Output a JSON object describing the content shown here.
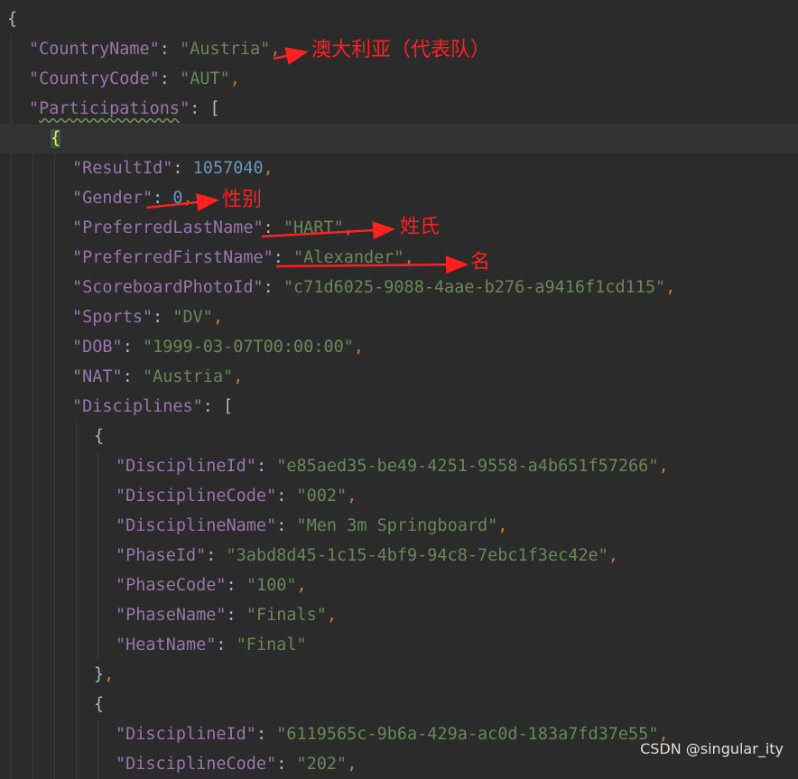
{
  "code_lines": [
    {
      "indent": 0,
      "tokens": [
        {
          "t": "{",
          "c": "b"
        }
      ]
    },
    {
      "indent": 1,
      "tokens": [
        {
          "t": "\"CountryName\"",
          "c": "k"
        },
        {
          "t": ": ",
          "c": "b"
        },
        {
          "t": "\"Austria\"",
          "c": "s"
        },
        {
          "t": ",",
          "c": "p"
        }
      ]
    },
    {
      "indent": 1,
      "tokens": [
        {
          "t": "\"CountryCode\"",
          "c": "k"
        },
        {
          "t": ": ",
          "c": "b"
        },
        {
          "t": "\"AUT\"",
          "c": "s"
        },
        {
          "t": ",",
          "c": "p"
        }
      ]
    },
    {
      "indent": 1,
      "tokens": [
        {
          "t": "\"",
          "c": "k"
        },
        {
          "t": "Participations",
          "c": "k squiggle"
        },
        {
          "t": "\"",
          "c": "k"
        },
        {
          "t": ": ",
          "c": "b"
        },
        {
          "t": "[",
          "c": "b"
        }
      ]
    },
    {
      "indent": 2,
      "current": true,
      "tokens": [
        {
          "t": "{",
          "c": "hl"
        }
      ]
    },
    {
      "indent": 3,
      "tokens": [
        {
          "t": "\"ResultId\"",
          "c": "k"
        },
        {
          "t": ": ",
          "c": "b"
        },
        {
          "t": "1057040",
          "c": "n"
        },
        {
          "t": ",",
          "c": "p"
        }
      ]
    },
    {
      "indent": 3,
      "tokens": [
        {
          "t": "\"Gender\"",
          "c": "k"
        },
        {
          "t": ": ",
          "c": "b"
        },
        {
          "t": "0",
          "c": "n"
        },
        {
          "t": ",",
          "c": "p"
        }
      ]
    },
    {
      "indent": 3,
      "tokens": [
        {
          "t": "\"PreferredLastName\"",
          "c": "k"
        },
        {
          "t": ": ",
          "c": "b"
        },
        {
          "t": "\"HART\"",
          "c": "s"
        },
        {
          "t": ",",
          "c": "p"
        }
      ]
    },
    {
      "indent": 3,
      "tokens": [
        {
          "t": "\"PreferredFirstName\"",
          "c": "k"
        },
        {
          "t": ": ",
          "c": "b"
        },
        {
          "t": "\"Alexander\"",
          "c": "s"
        },
        {
          "t": ",",
          "c": "p"
        }
      ]
    },
    {
      "indent": 3,
      "tokens": [
        {
          "t": "\"ScoreboardPhotoId\"",
          "c": "k"
        },
        {
          "t": ": ",
          "c": "b"
        },
        {
          "t": "\"c71d6025-9088-4aae-b276-a9416f1cd115\"",
          "c": "s"
        },
        {
          "t": ",",
          "c": "p"
        }
      ]
    },
    {
      "indent": 3,
      "tokens": [
        {
          "t": "\"Sports\"",
          "c": "k"
        },
        {
          "t": ": ",
          "c": "b"
        },
        {
          "t": "\"DV\"",
          "c": "s"
        },
        {
          "t": ",",
          "c": "p"
        }
      ]
    },
    {
      "indent": 3,
      "tokens": [
        {
          "t": "\"DOB\"",
          "c": "k"
        },
        {
          "t": ": ",
          "c": "b"
        },
        {
          "t": "\"1999-03-07T00:00:00\"",
          "c": "s"
        },
        {
          "t": ",",
          "c": "p"
        }
      ]
    },
    {
      "indent": 3,
      "tokens": [
        {
          "t": "\"NAT\"",
          "c": "k"
        },
        {
          "t": ": ",
          "c": "b"
        },
        {
          "t": "\"Austria\"",
          "c": "s"
        },
        {
          "t": ",",
          "c": "p"
        }
      ]
    },
    {
      "indent": 3,
      "tokens": [
        {
          "t": "\"Disciplines\"",
          "c": "k"
        },
        {
          "t": ": ",
          "c": "b"
        },
        {
          "t": "[",
          "c": "b"
        }
      ]
    },
    {
      "indent": 4,
      "tokens": [
        {
          "t": "{",
          "c": "b"
        }
      ]
    },
    {
      "indent": 5,
      "tokens": [
        {
          "t": "\"DisciplineId\"",
          "c": "k"
        },
        {
          "t": ": ",
          "c": "b"
        },
        {
          "t": "\"e85aed35-be49-4251-9558-a4b651f57266\"",
          "c": "s"
        },
        {
          "t": ",",
          "c": "p"
        }
      ]
    },
    {
      "indent": 5,
      "tokens": [
        {
          "t": "\"DisciplineCode\"",
          "c": "k"
        },
        {
          "t": ": ",
          "c": "b"
        },
        {
          "t": "\"002\"",
          "c": "s"
        },
        {
          "t": ",",
          "c": "p"
        }
      ]
    },
    {
      "indent": 5,
      "tokens": [
        {
          "t": "\"DisciplineName\"",
          "c": "k"
        },
        {
          "t": ": ",
          "c": "b"
        },
        {
          "t": "\"Men 3m Springboard\"",
          "c": "s"
        },
        {
          "t": ",",
          "c": "p"
        }
      ]
    },
    {
      "indent": 5,
      "tokens": [
        {
          "t": "\"PhaseId\"",
          "c": "k"
        },
        {
          "t": ": ",
          "c": "b"
        },
        {
          "t": "\"3abd8d45-1c15-4bf9-94c8-7ebc1f3ec42e\"",
          "c": "s"
        },
        {
          "t": ",",
          "c": "p"
        }
      ]
    },
    {
      "indent": 5,
      "tokens": [
        {
          "t": "\"PhaseCode\"",
          "c": "k"
        },
        {
          "t": ": ",
          "c": "b"
        },
        {
          "t": "\"100\"",
          "c": "s"
        },
        {
          "t": ",",
          "c": "p"
        }
      ]
    },
    {
      "indent": 5,
      "tokens": [
        {
          "t": "\"PhaseName\"",
          "c": "k"
        },
        {
          "t": ": ",
          "c": "b"
        },
        {
          "t": "\"Finals\"",
          "c": "s"
        },
        {
          "t": ",",
          "c": "p"
        }
      ]
    },
    {
      "indent": 5,
      "tokens": [
        {
          "t": "\"HeatName\"",
          "c": "k"
        },
        {
          "t": ": ",
          "c": "b"
        },
        {
          "t": "\"Final\"",
          "c": "s"
        }
      ]
    },
    {
      "indent": 4,
      "tokens": [
        {
          "t": "}",
          "c": "b"
        },
        {
          "t": ",",
          "c": "p"
        }
      ]
    },
    {
      "indent": 4,
      "tokens": [
        {
          "t": "{",
          "c": "b"
        }
      ]
    },
    {
      "indent": 5,
      "tokens": [
        {
          "t": "\"DisciplineId\"",
          "c": "k"
        },
        {
          "t": ": ",
          "c": "b"
        },
        {
          "t": "\"6119565c-9b6a-429a-ac0d-183a7fd37e55\"",
          "c": "s"
        },
        {
          "t": ",",
          "c": "p"
        }
      ]
    },
    {
      "indent": 5,
      "tokens": [
        {
          "t": "\"DisciplineCode\"",
          "c": "k"
        },
        {
          "t": ": ",
          "c": "b"
        },
        {
          "t": "\"202\"",
          "c": "s"
        },
        {
          "t": ",",
          "c": "p"
        }
      ]
    }
  ],
  "annotations": [
    {
      "text": "澳大利亚（代表队）",
      "line": 1
    },
    {
      "text": "性别",
      "line": 6
    },
    {
      "text": "姓氏",
      "line": 7
    },
    {
      "text": "名",
      "line": 8
    }
  ],
  "colors": {
    "background": "#2b2b2b",
    "key": "#9876aa",
    "string": "#6a8759",
    "number": "#6897bb",
    "punctuation": "#cc7832",
    "annotation": "#ff2020"
  },
  "watermark": "CSDN @singular_ity"
}
